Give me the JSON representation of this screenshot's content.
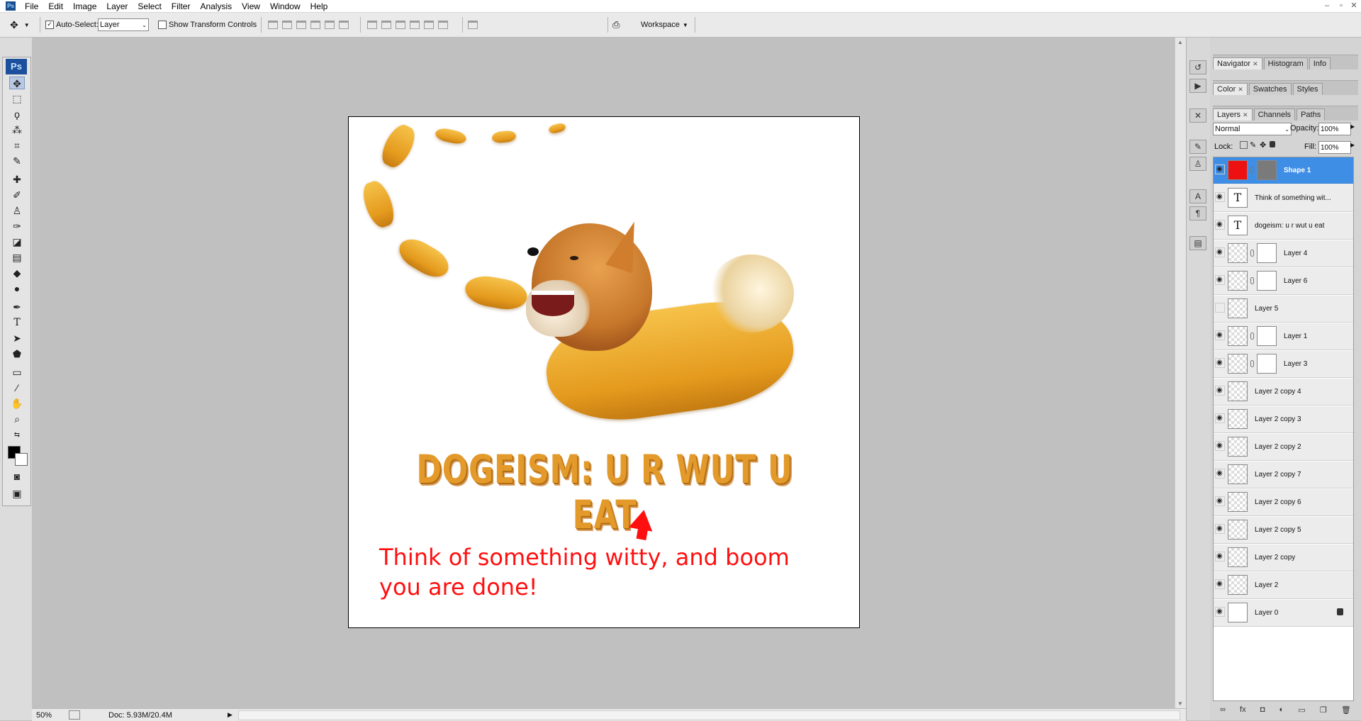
{
  "menubar": {
    "items": [
      "File",
      "Edit",
      "Image",
      "Layer",
      "Select",
      "Filter",
      "Analysis",
      "View",
      "Window",
      "Help"
    ]
  },
  "options": {
    "auto_select_label": "Auto-Select:",
    "auto_select_value": "Layer",
    "show_transform_label": "Show Transform Controls",
    "workspace_label": "Workspace"
  },
  "toolbox": {
    "badge": "Ps"
  },
  "document": {
    "headline": "DOGEISM: U R WUT U EAT",
    "caption": "Think of something witty, and boom you are done!"
  },
  "status": {
    "zoom": "50%",
    "doc_info": "Doc: 5.93M/20.4M"
  },
  "panels": {
    "group1_tabs": [
      "Navigator",
      "Histogram",
      "Info"
    ],
    "group2_tabs": [
      "Color",
      "Swatches",
      "Styles"
    ],
    "group3_tabs": [
      "Layers",
      "Channels",
      "Paths"
    ],
    "blend_mode": "Normal",
    "opacity_label": "Opacity:",
    "opacity_value": "100%",
    "lock_label": "Lock:",
    "fill_label": "Fill:",
    "fill_value": "100%"
  },
  "layers": [
    {
      "name": "Shape 1",
      "visible": true,
      "thumb": "red",
      "mask": "gray",
      "selected": true
    },
    {
      "name": "Think of something wit...",
      "visible": true,
      "thumb": "text",
      "mask": null
    },
    {
      "name": "dogeism: u r wut u eat",
      "visible": true,
      "thumb": "text",
      "mask": null
    },
    {
      "name": "Layer 4",
      "visible": true,
      "thumb": "checker",
      "mask": "white"
    },
    {
      "name": "Layer 6",
      "visible": true,
      "thumb": "checker",
      "mask": "white"
    },
    {
      "name": "Layer 5",
      "visible": false,
      "thumb": "checker",
      "mask": null
    },
    {
      "name": "Layer 1",
      "visible": true,
      "thumb": "checker",
      "mask": "white"
    },
    {
      "name": "Layer 3",
      "visible": true,
      "thumb": "checker",
      "mask": "white"
    },
    {
      "name": "Layer 2 copy 4",
      "visible": true,
      "thumb": "checker",
      "mask": null
    },
    {
      "name": "Layer 2 copy 3",
      "visible": true,
      "thumb": "checker",
      "mask": null
    },
    {
      "name": "Layer 2 copy 2",
      "visible": true,
      "thumb": "checker",
      "mask": null
    },
    {
      "name": "Layer 2 copy 7",
      "visible": true,
      "thumb": "checker",
      "mask": null
    },
    {
      "name": "Layer 2 copy 6",
      "visible": true,
      "thumb": "checker",
      "mask": null
    },
    {
      "name": "Layer 2 copy 5",
      "visible": true,
      "thumb": "checker",
      "mask": null
    },
    {
      "name": "Layer 2 copy",
      "visible": true,
      "thumb": "checker",
      "mask": null
    },
    {
      "name": "Layer 2",
      "visible": true,
      "thumb": "checker",
      "mask": null
    },
    {
      "name": "Layer 0",
      "visible": true,
      "thumb": "white",
      "mask": null,
      "locked": true
    }
  ],
  "colors": {
    "selection": "#3f8ee6",
    "caption_red": "#ff1010",
    "headline_orange": "#e39a2a"
  }
}
